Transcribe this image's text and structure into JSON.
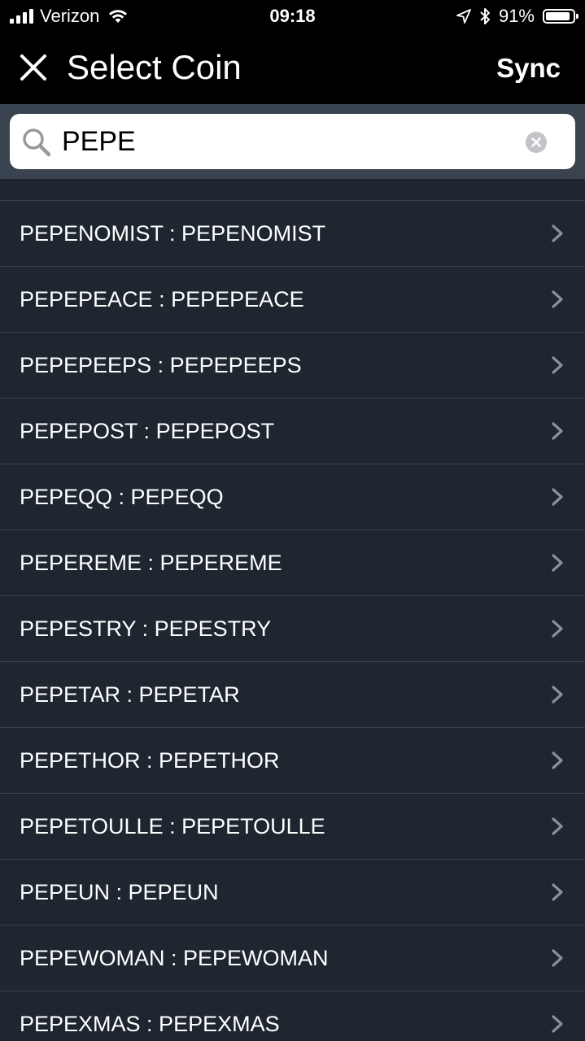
{
  "status_bar": {
    "carrier": "Verizon",
    "time": "09:18",
    "battery": "91%",
    "battery_level": 0.91
  },
  "nav": {
    "close_icon": "close-icon",
    "title": "Select Coin",
    "sync_label": "Sync"
  },
  "search": {
    "value": "PEPE",
    "search_icon": "search-icon",
    "clear_icon": "clear-icon"
  },
  "coins": [
    {
      "label": "PEPENOMIST : PEPENOMIST"
    },
    {
      "label": "PEPEPEACE : PEPEPEACE"
    },
    {
      "label": "PEPEPEEPS : PEPEPEEPS"
    },
    {
      "label": "PEPEPOST : PEPEPOST"
    },
    {
      "label": "PEPEQQ : PEPEQQ"
    },
    {
      "label": "PEPEREME : PEPEREME"
    },
    {
      "label": "PEPESTRY : PEPESTRY"
    },
    {
      "label": "PEPETAR : PEPETAR"
    },
    {
      "label": "PEPETHOR : PEPETHOR"
    },
    {
      "label": "PEPETOULLE : PEPETOULLE"
    },
    {
      "label": "PEPEUN : PEPEUN"
    },
    {
      "label": "PEPEWOMAN : PEPEWOMAN"
    },
    {
      "label": "PEPEXMAS : PEPEXMAS"
    }
  ],
  "colors": {
    "background": "#1e2630",
    "header": "#000000",
    "search_band": "#3a4450",
    "row_divider": "#3a4350",
    "chevron": "#8a9099"
  }
}
